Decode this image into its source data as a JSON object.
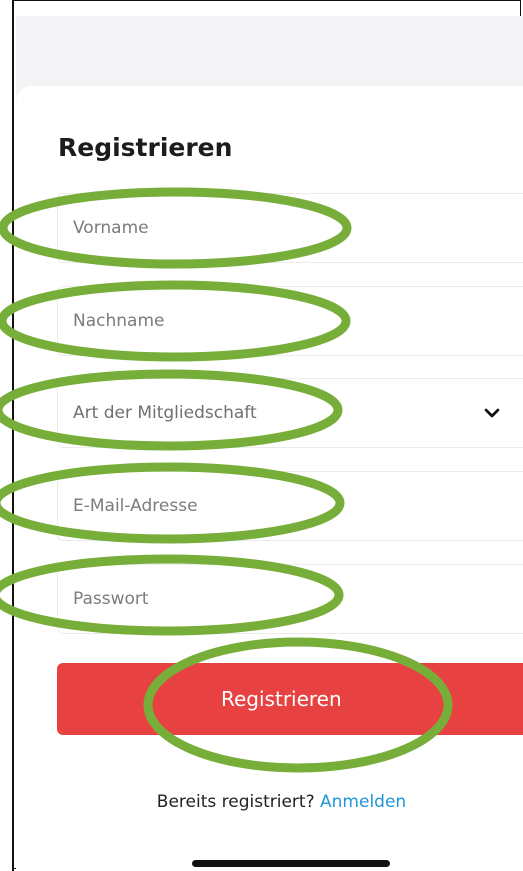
{
  "form": {
    "title": "Registrieren",
    "first_name_placeholder": "Vorname",
    "last_name_placeholder": "Nachname",
    "membership_label": "Art der Mitgliedschaft",
    "email_placeholder": "E-Mail-Adresse",
    "password_placeholder": "Passwort",
    "submit_label": "Registrieren"
  },
  "footer": {
    "already_registered": "Bereits registriert?",
    "login_link": "Anmelden"
  },
  "icons": {
    "membership_dropdown": "chevron-down-icon"
  },
  "colors": {
    "primary_button": "#e84141",
    "link": "#2096d8",
    "annotation": "#77ae3a",
    "title": "#1c1c1c"
  }
}
